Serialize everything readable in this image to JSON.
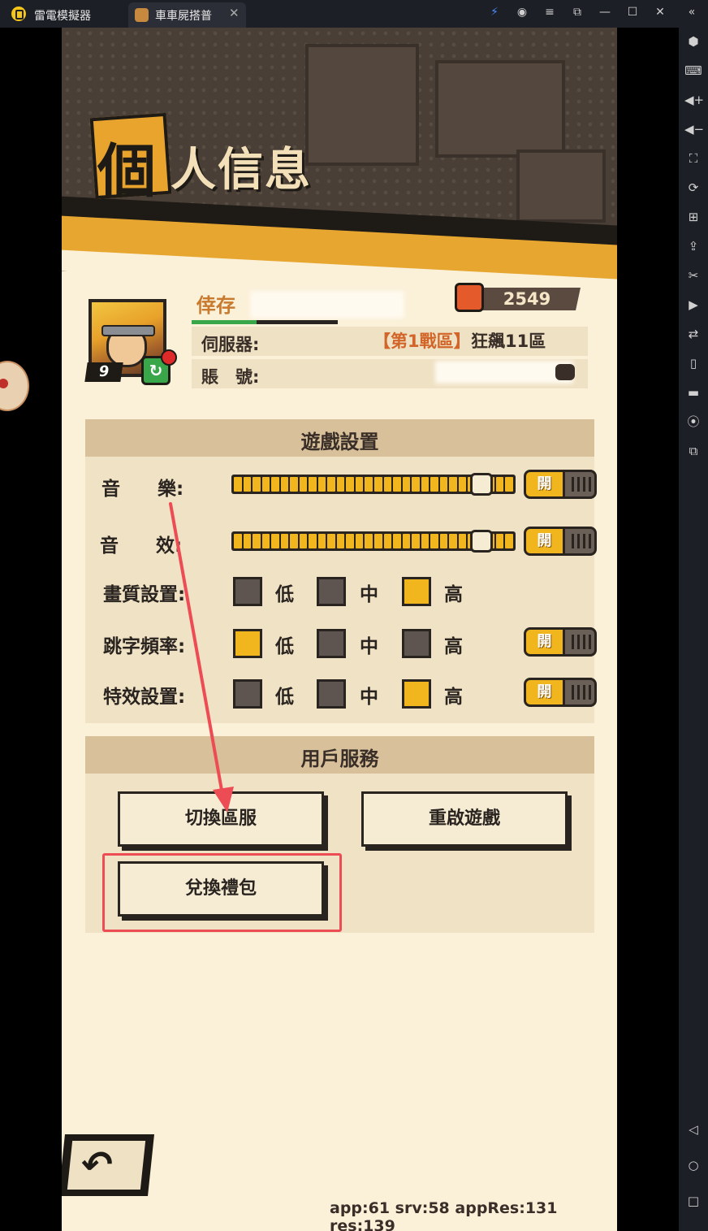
{
  "window": {
    "app_name": "雷電模擬器",
    "tab_title": "車車屍搭普",
    "tab_close": "✕",
    "controls": [
      "⚡",
      "◉",
      "≡",
      "⧉",
      "—",
      "☐",
      "✕",
      "«"
    ]
  },
  "sidebar": {
    "icons": [
      "gear-icon",
      "keyboard-icon",
      "volume-up-icon",
      "volume-down-icon",
      "screenshot-icon",
      "rotate-icon",
      "add-icon",
      "apk-icon",
      "cut-icon",
      "record-icon",
      "sync-icon",
      "shake-icon",
      "folder-icon",
      "location-icon",
      "multi-instance-icon",
      "back-nav-icon",
      "home-nav-icon",
      "recent-nav-icon"
    ],
    "glyphs": [
      "⬢",
      "⌨",
      "◀+",
      "◀−",
      "⛶",
      "⟳",
      "⊞",
      "⇪",
      "✂",
      "▶",
      "⇄",
      "▯",
      "▬",
      "⦿",
      "⧉",
      "◁",
      "○",
      "□"
    ]
  },
  "page": {
    "title_first": "個",
    "title_rest": "人信息"
  },
  "profile": {
    "name": "倖存",
    "level": "9",
    "sync_glyph": "↻",
    "power": "2549",
    "server_label": "伺服器:",
    "server_zone": "【第1戰區】",
    "server_name": "狂飆11區",
    "account_label": "賬　號:"
  },
  "settings": {
    "title": "遊戲設置",
    "music_label": "音　　樂:",
    "sound_label": "音　　效:",
    "music_level": 1.0,
    "sound_level": 1.0,
    "toggle_on": "開",
    "quality_label": "畫質設置:",
    "damage_label": "跳字頻率:",
    "effects_label": "特效設置:",
    "opt_low": "低",
    "opt_mid": "中",
    "opt_high": "高",
    "quality_selected": "高",
    "damage_selected": "低",
    "effects_selected": "高"
  },
  "service": {
    "title": "用戶服務",
    "switch_server": "切換區服",
    "restart_game": "重啟遊戲",
    "redeem_gift": "兌換禮包"
  },
  "back_glyph": "↶",
  "debug": "app:61 srv:58 appRes:131 res:139",
  "colors": {
    "accent": "#f1b51e",
    "annotation": "#ee4c55",
    "panel_bg": "#f0e2c4"
  }
}
